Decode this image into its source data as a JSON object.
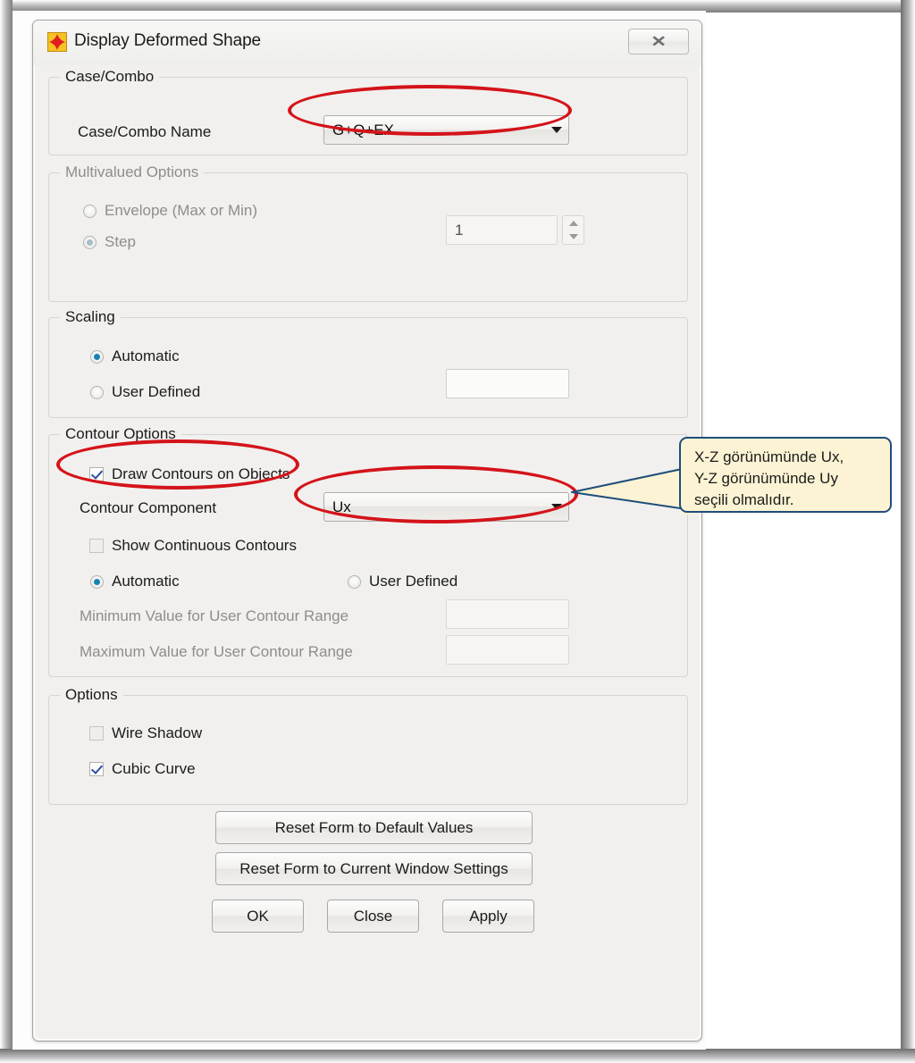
{
  "window": {
    "title": "Display Deformed Shape",
    "app_icon": "sap2000-star-icon",
    "close_label": "✕",
    "close_icon": "close-icon"
  },
  "case_combo": {
    "legend": "Case/Combo",
    "name_label": "Case/Combo Name",
    "name_value": "G+Q+EX"
  },
  "multivalued": {
    "legend": "Multivalued Options",
    "envelope_label": "Envelope (Max or Min)",
    "step_label": "Step",
    "step_value": "1"
  },
  "scaling": {
    "legend": "Scaling",
    "automatic_label": "Automatic",
    "user_defined_label": "User Defined",
    "user_defined_value": ""
  },
  "contour": {
    "legend": "Contour Options",
    "draw_contours_label": "Draw Contours on Objects",
    "component_label": "Contour Component",
    "component_value": "Ux",
    "show_continuous_label": "Show Continuous Contours",
    "automatic_label": "Automatic",
    "user_defined_label": "User Defined",
    "min_label": "Minimum Value for User Contour Range",
    "min_value": "",
    "max_label": "Maximum Value for User Contour Range",
    "max_value": ""
  },
  "options": {
    "legend": "Options",
    "wire_shadow_label": "Wire Shadow",
    "cubic_curve_label": "Cubic Curve"
  },
  "buttons": {
    "reset_default": "Reset Form to Default Values",
    "reset_current": "Reset Form to Current Window Settings",
    "ok": "OK",
    "close": "Close",
    "apply": "Apply"
  },
  "annotations": {
    "ellipse_color": "#d4131a",
    "callout_text": "X-Z görünümünde Ux,\nY-Z görünümünde Uy\nseçili olmalıdır.",
    "callout_bg": "#fcf3d4",
    "callout_border": "#1f4e79"
  }
}
